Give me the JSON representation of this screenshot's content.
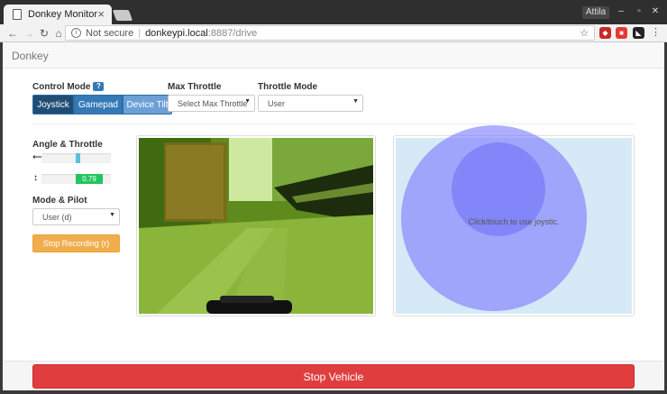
{
  "browser": {
    "tab_title": "Donkey Monitor",
    "tab_close": "×",
    "user_name": "Attila",
    "security_label": "Not secure",
    "url_host": "donkeypi.local",
    "url_path": ":8887/drive"
  },
  "navbar": {
    "brand": "Donkey"
  },
  "controls": {
    "control_mode_label": "Control Mode",
    "help_badge": "?",
    "mode_buttons": [
      "Joystick",
      "Gamepad",
      "Device Tilt"
    ],
    "active_mode": "Joystick",
    "max_throttle_label": "Max Throttle",
    "max_throttle_value": "Select Max Throttle",
    "throttle_mode_label": "Throttle Mode",
    "throttle_mode_value": "User"
  },
  "telemetry": {
    "angle_throttle_label": "Angle & Throttle",
    "angle_value": 0,
    "throttle_value": "0.79",
    "mode_pilot_label": "Mode & Pilot",
    "mode_pilot_value": "User (d)",
    "record_button": "Stop Recording (r)"
  },
  "joystick": {
    "hint": "Click/touch to use joystic."
  },
  "footer": {
    "stop_button": "Stop Vehicle"
  },
  "colors": {
    "primary": "#337ab7",
    "warning": "#f0ad4e",
    "danger": "#e03e3e",
    "success": "#22c55e",
    "info": "#5bc0de"
  }
}
